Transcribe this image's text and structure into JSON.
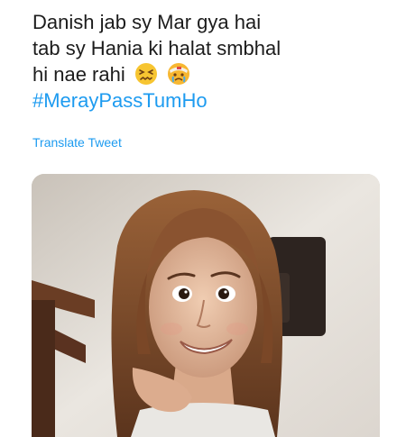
{
  "tweet": {
    "lines": [
      "Danish jab sy Mar gya hai",
      "tab sy Hania ki halat smbhal",
      "hi nae rahi"
    ],
    "emojis": [
      "confounded-face-emoji",
      "face-with-head-bandage-crying-emoji"
    ],
    "hashtag": "#MerayPassTumHo",
    "translate_label": "Translate Tweet"
  },
  "media": {
    "icon": "photo-of-woman-smiling",
    "colors": {
      "wall": "#e6e1da",
      "hair": "#7a4a2c",
      "skin": "#e2b89a",
      "chair": "#4a2c1c"
    }
  },
  "colors": {
    "text": "#1c1c1c",
    "link": "#1d9bf0"
  }
}
